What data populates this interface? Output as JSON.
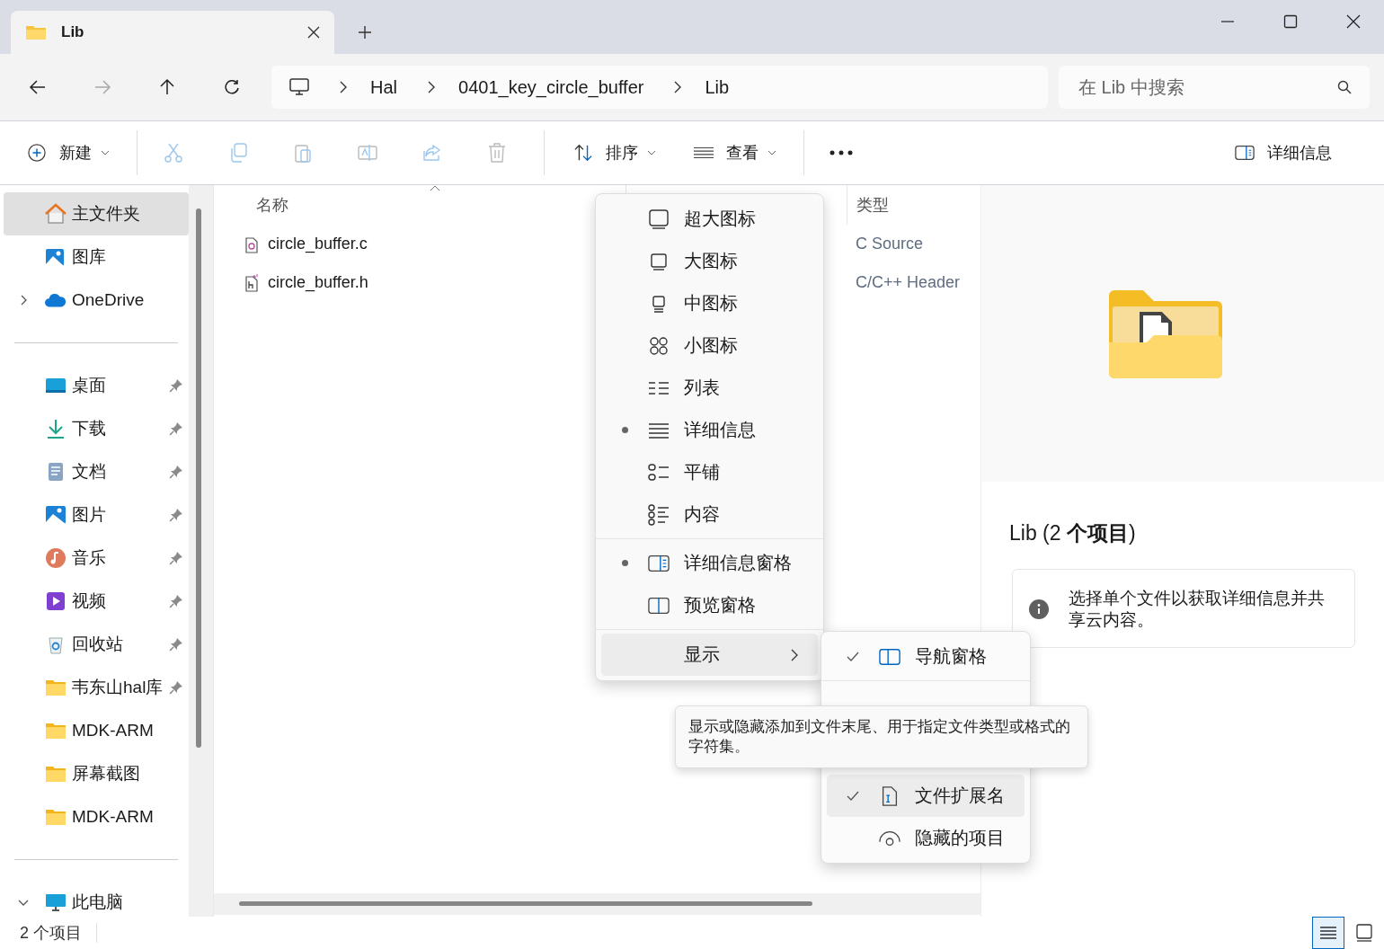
{
  "tab": {
    "title": "Lib"
  },
  "nav_buttons": [
    {
      "disabled": false
    },
    {
      "disabled": true
    },
    {
      "disabled": false
    },
    {
      "disabled": false
    }
  ],
  "breadcrumb": [
    "Hal",
    "0401_key_circle_buffer",
    "Lib"
  ],
  "search": {
    "placeholder": "在 Lib 中搜索"
  },
  "toolbar": {
    "new": "新建",
    "actions": [
      {
        "disabled": true
      },
      {
        "disabled": true
      },
      {
        "disabled": true
      },
      {
        "disabled": true
      },
      {
        "disabled": true
      },
      {
        "disabled": true
      }
    ],
    "sort": "排序",
    "view": "查看",
    "details": "详细信息"
  },
  "sidebar": {
    "top": [
      {
        "label": "主文件夹",
        "selected": true
      },
      {
        "label": "图库",
        "selected": false
      },
      {
        "label": "OneDrive",
        "selected": false,
        "expanded": false
      }
    ],
    "quick": [
      {
        "label": "桌面",
        "pinned": true
      },
      {
        "label": "下载",
        "pinned": true
      },
      {
        "label": "文档",
        "pinned": true
      },
      {
        "label": "图片",
        "pinned": true
      },
      {
        "label": "音乐",
        "pinned": true
      },
      {
        "label": "视频",
        "pinned": true
      },
      {
        "label": "回收站",
        "pinned": true
      },
      {
        "label": "韦东山hal库",
        "pinned": true
      },
      {
        "label": "MDK-ARM",
        "pinned": false
      },
      {
        "label": "屏幕截图",
        "pinned": false
      },
      {
        "label": "MDK-ARM",
        "pinned": false
      }
    ],
    "this_pc": {
      "label": "此电脑",
      "expanded": true
    }
  },
  "file_list": {
    "columns": [
      {
        "label": "名称",
        "sorted": true
      },
      {
        "label": "类型",
        "sorted": false
      }
    ],
    "rows": [
      {
        "name": "circle_buffer.c",
        "type": "C Source",
        "kind": "source"
      },
      {
        "name": "circle_buffer.h",
        "type": "C/C++ Header",
        "kind": "header"
      }
    ]
  },
  "details_pane": {
    "title": "Lib (2 **个项目**)",
    "info": "选择单个文件以获取详细信息并共享云内容。"
  },
  "view_menu": {
    "view_modes": [
      {
        "label": "超大图标",
        "selected": false
      },
      {
        "label": "大图标",
        "selected": false
      },
      {
        "label": "中图标",
        "selected": false
      },
      {
        "label": "小图标",
        "selected": false
      },
      {
        "label": "列表",
        "selected": false
      },
      {
        "label": "详细信息",
        "selected": true
      },
      {
        "label": "平铺",
        "selected": false
      },
      {
        "label": "内容",
        "selected": false
      }
    ],
    "panes": [
      {
        "label": "详细信息窗格",
        "selected": true
      },
      {
        "label": "预览窗格",
        "selected": false
      }
    ],
    "show": {
      "label": "显示",
      "expanded": true
    }
  },
  "show_submenu": {
    "items": [
      {
        "label": "导航窗格",
        "checked": true,
        "highlighted": false
      },
      {
        "label": "文件扩展名",
        "checked": true,
        "highlighted": true
      },
      {
        "label": "隐藏的项目",
        "checked": false,
        "highlighted": false
      }
    ]
  },
  "tooltip": {
    "text": "显示或隐藏添加到文件末尾、用于指定文件类型或格式的字符集。"
  },
  "status_bar": {
    "count": "2 个项目",
    "views": [
      {
        "selected": true
      },
      {
        "selected": false
      }
    ]
  }
}
